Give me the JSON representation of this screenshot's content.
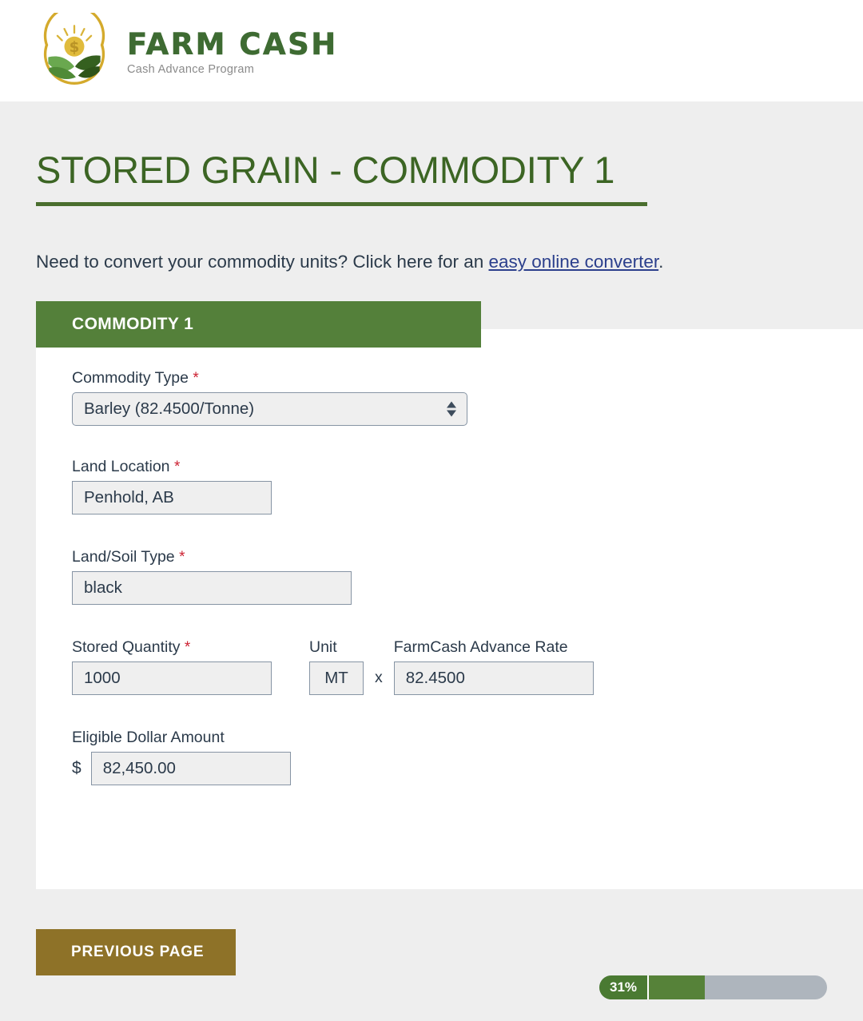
{
  "brand": {
    "logo_icon": "farm-sun-field-logo",
    "wordmark": "FARM CASH",
    "tagline": "Cash Advance Program"
  },
  "page": {
    "title": "STORED GRAIN - COMMODITY 1",
    "converter_prefix": "Need to convert your commodity units? Click here for an ",
    "converter_link": "easy online converter",
    "converter_suffix": "."
  },
  "section": {
    "header_label": "COMMODITY 1"
  },
  "fields": {
    "commodity_type": {
      "label": "Commodity Type",
      "required_marker": "*",
      "value": "Barley (82.4500/Tonne)",
      "options": [
        "Barley (82.4500/Tonne)"
      ]
    },
    "land_location": {
      "label": "Land Location",
      "required_marker": "*",
      "value": "Penhold, AB"
    },
    "land_soil_type": {
      "label": "Land/Soil Type",
      "required_marker": "*",
      "value": "black"
    },
    "stored_quantity": {
      "label": "Stored Quantity",
      "required_marker": "*",
      "value": "1000"
    },
    "unit": {
      "label": "Unit",
      "value": "MT"
    },
    "multiply_symbol": "x",
    "advance_rate": {
      "label": "FarmCash Advance Rate",
      "value": "82.4500"
    },
    "eligible_dollar_amount": {
      "label": "Eligible Dollar Amount",
      "currency_symbol": "$",
      "value": "82,450.00"
    }
  },
  "footer": {
    "previous_page_label": "PREVIOUS PAGE",
    "progress_percent_label": "31%",
    "progress_percent_value": 31
  },
  "colors": {
    "page_background": "#eeeeee",
    "brand_green": "#3e6b32",
    "title_green": "#3c6524",
    "section_header_green": "#54803a",
    "progress_green": "#568239",
    "progress_track_gray": "#aeb5bd",
    "button_gold": "#8e7228",
    "link_blue": "#2b3f8c",
    "required_red": "#cc2031",
    "field_fill": "#efefef",
    "field_border": "#8694a4"
  }
}
